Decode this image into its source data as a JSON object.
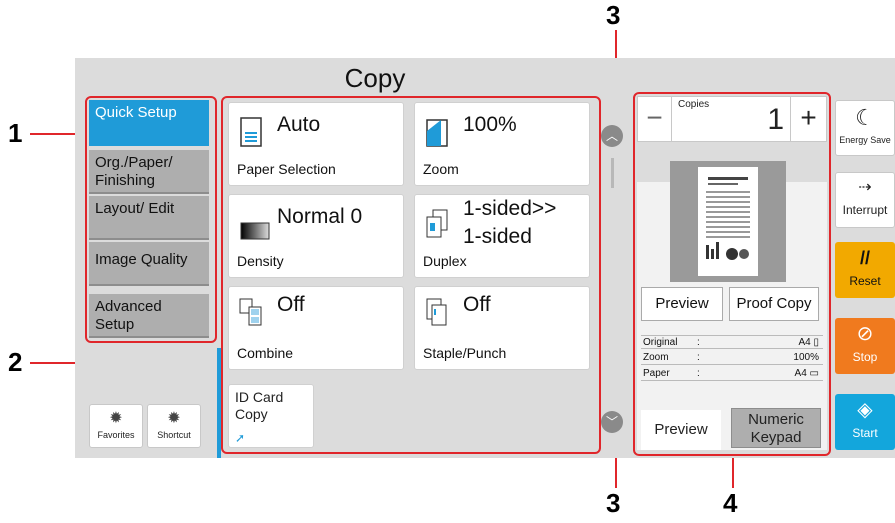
{
  "callouts": [
    "1",
    "2",
    "3",
    "3",
    "4"
  ],
  "screen": {
    "title": "Copy",
    "tabs": [
      {
        "label": "Quick Setup"
      },
      {
        "label": "Org./Paper/ Finishing"
      },
      {
        "label": "Layout/ Edit"
      },
      {
        "label": "Image Quality"
      },
      {
        "label": "Advanced Setup"
      }
    ],
    "bottom_left": {
      "favorites": "Favorites",
      "shortcut": "Shortcut"
    },
    "tiles": {
      "paper_selection": {
        "value": "Auto",
        "label": "Paper Selection"
      },
      "zoom": {
        "value": "100%",
        "label": "Zoom"
      },
      "density": {
        "value": "Normal 0",
        "label": "Density"
      },
      "duplex": {
        "value_line1": "1-sided>>",
        "value_line2": "1-sided",
        "label": "Duplex"
      },
      "combine": {
        "value": "Off",
        "label": "Combine"
      },
      "staple_punch": {
        "value": "Off",
        "label": "Staple/Punch"
      },
      "id_card_copy": {
        "label_line1": "ID Card",
        "label_line2": "Copy"
      }
    },
    "copies": {
      "label": "Copies",
      "value": "1",
      "minus": "−",
      "plus": "+"
    },
    "preview_buttons": {
      "preview": "Preview",
      "proof_copy": "Proof Copy"
    },
    "info": [
      {
        "key": "Original",
        "sep": ":",
        "value": "A4"
      },
      {
        "key": "Zoom",
        "sep": ":",
        "value": "100%"
      },
      {
        "key": "Paper",
        "sep": ":",
        "value": "A4"
      }
    ],
    "bottom_right": {
      "preview": "Preview",
      "numeric_keypad_line1": "Numeric",
      "numeric_keypad_line2": "Keypad"
    },
    "side_buttons": [
      {
        "label": "Energy Save",
        "icon": "moon-icon",
        "color": "#ffffff"
      },
      {
        "label": "Interrupt",
        "icon": "interrupt-icon",
        "color": "#ffffff"
      },
      {
        "label": "Reset",
        "icon": "reset-icon",
        "color": "#f2a900"
      },
      {
        "label": "Stop",
        "icon": "stop-icon",
        "color": "#f07a1e"
      },
      {
        "label": "Start",
        "icon": "start-icon",
        "color": "#13a6dc"
      }
    ]
  },
  "colors": {
    "accent": "#1f9bd8",
    "callout": "#e0262b",
    "panel": "#dcdcdc"
  }
}
